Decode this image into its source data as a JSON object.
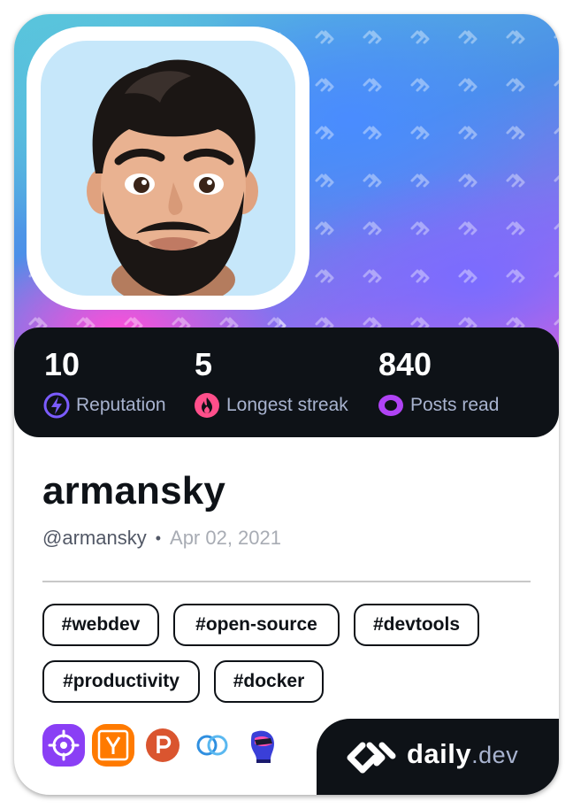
{
  "stats": [
    {
      "value": "10",
      "label": "Reputation",
      "icon": "lightning-icon",
      "color": "#7b5cff"
    },
    {
      "value": "5",
      "label": "Longest streak",
      "icon": "flame-icon",
      "color": "#ff4f8b"
    },
    {
      "value": "840",
      "label": "Posts read",
      "icon": "eye-ring-icon",
      "color": "#b043f5"
    }
  ],
  "profile": {
    "name": "armansky",
    "handle": "@armansky",
    "separator": "•",
    "joined": "Apr 02, 2021"
  },
  "tags": [
    "#webdev",
    "#open-source",
    "#devtools",
    "#productivity",
    "#docker"
  ],
  "sources": [
    {
      "icon": "crosshair-source-icon",
      "color": "#8a3ff5"
    },
    {
      "icon": "ycombinator-source-icon",
      "color": "#ff7a00"
    },
    {
      "icon": "producthunt-source-icon",
      "color": "#da552f"
    },
    {
      "icon": "linked-rings-source-icon",
      "color": "#2f8fe0"
    },
    {
      "icon": "vr-head-source-icon",
      "color": "#1a1a6e"
    }
  ],
  "brand": {
    "name": "daily",
    "suffix": ".dev"
  }
}
